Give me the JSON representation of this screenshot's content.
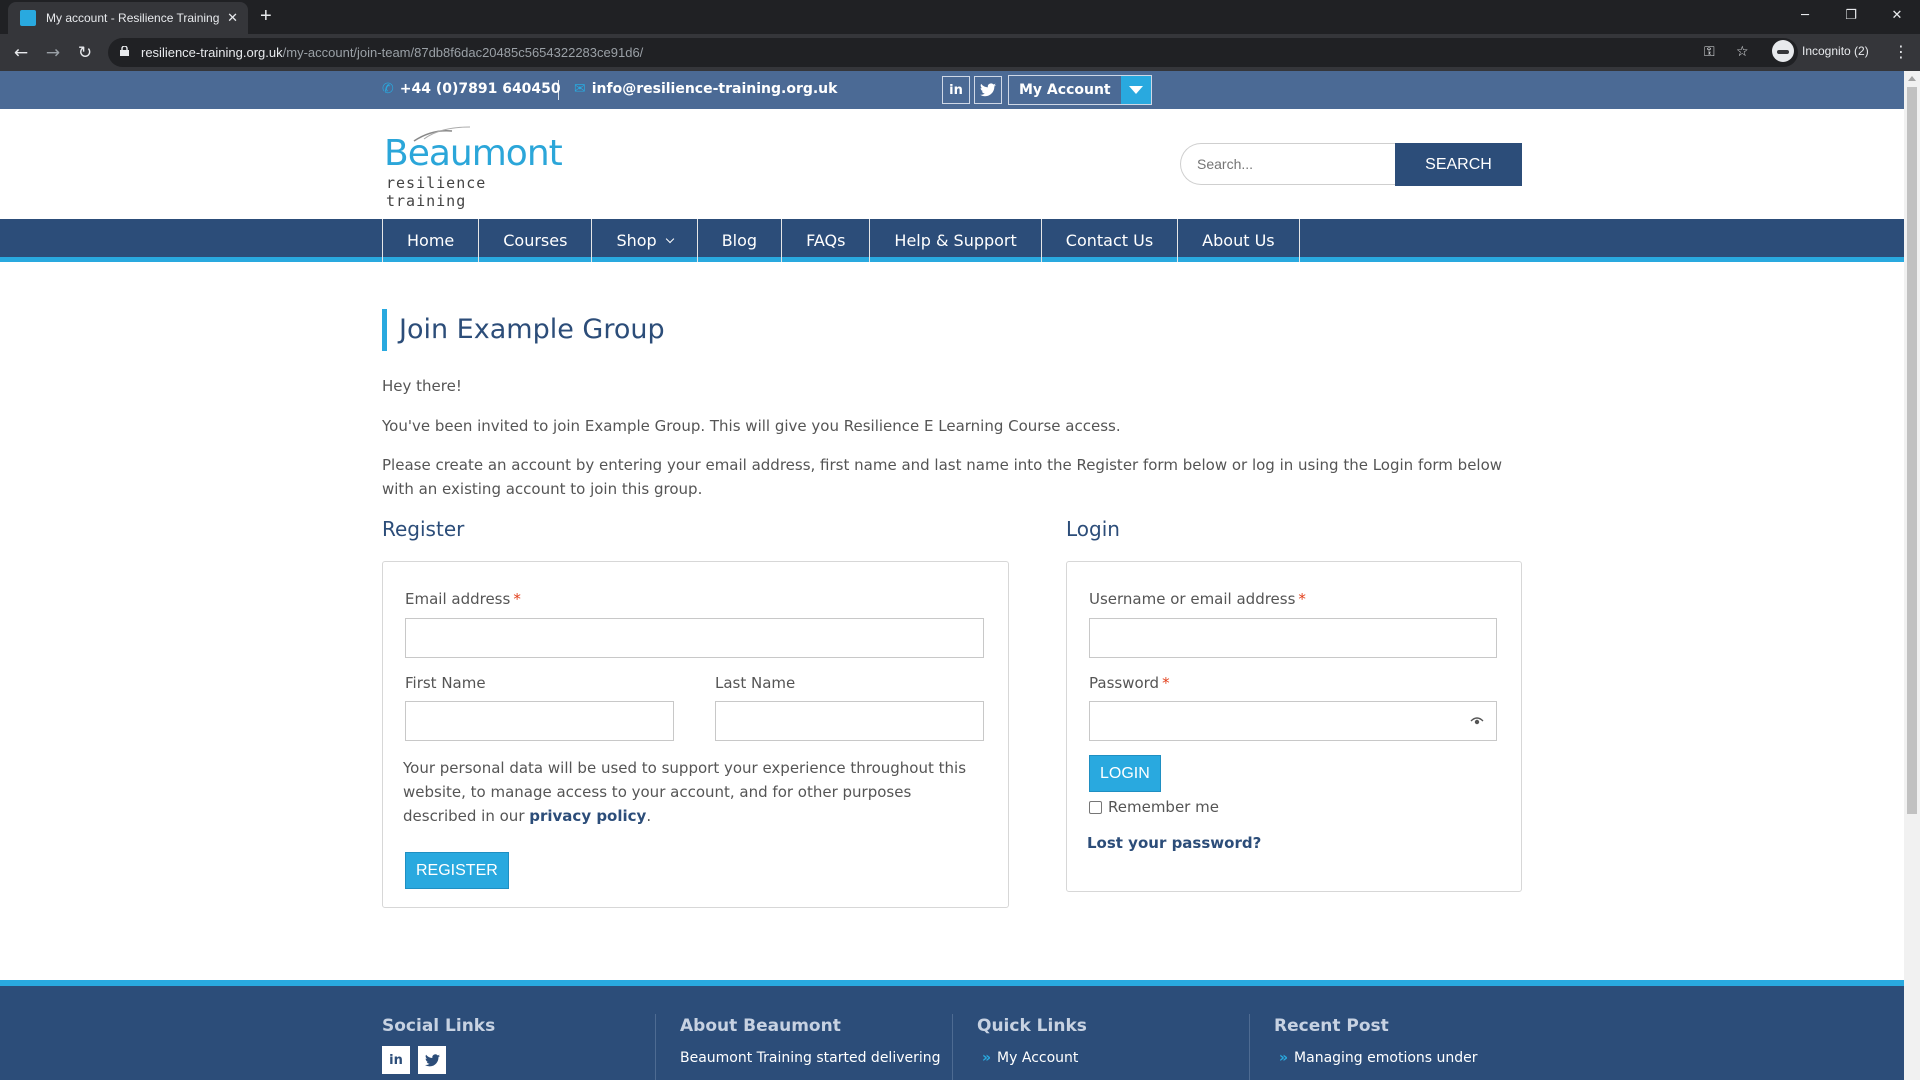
{
  "browser": {
    "tab_title": "My account - Resilience Training",
    "url_host": "resilience-training.org.uk",
    "url_path": "/my-account/join-team/87db8f6dac20485c5654322283ce91d6/",
    "profile_label": "Incognito (2)"
  },
  "topbar": {
    "phone": "+44 (0)7891 640450",
    "email": "info@resilience-training.org.uk",
    "linkedin_label": "in",
    "my_account_label": "My Account"
  },
  "header": {
    "logo_main": "Beaumont",
    "logo_sub": "resilience training",
    "search_placeholder": "Search...",
    "search_button": "SEARCH"
  },
  "nav": {
    "items": [
      "Home",
      "Courses",
      "Shop",
      "Blog",
      "FAQs",
      "Help & Support",
      "Contact Us",
      "About Us"
    ]
  },
  "content": {
    "title": "Join Example Group",
    "greeting": "Hey there!",
    "invite_text": "You've been invited to join Example Group. This will give you Resilience E Learning Course access.",
    "instructions": "Please create an account by entering your email address, first name and last name into the Register form below or log in using the Login form below with an existing account to join this group."
  },
  "register": {
    "heading": "Register",
    "email_label": "Email address",
    "required_mark": "*",
    "first_name_label": "First Name",
    "last_name_label": "Last Name",
    "privacy_text_before": "Your personal data will be used to support your experience throughout this website, to manage access to your account, and for other purposes described in our ",
    "privacy_link": "privacy policy",
    "privacy_text_after": ".",
    "button": "REGISTER"
  },
  "login": {
    "heading": "Login",
    "username_label": "Username or email address",
    "password_label": "Password",
    "button": "LOGIN",
    "remember_label": "Remember me",
    "lost_password": "Lost your password?"
  },
  "footer": {
    "social_heading": "Social Links",
    "about_heading": "About Beaumont",
    "about_text": "Beaumont Training started delivering",
    "quick_heading": "Quick Links",
    "quick_item": "My Account",
    "recent_heading": "Recent Post",
    "recent_item": "Managing emotions under"
  },
  "colors": {
    "primary_navy": "#2c4d79",
    "accent_blue": "#29a9df",
    "topbar_blue": "#4b6a95"
  }
}
